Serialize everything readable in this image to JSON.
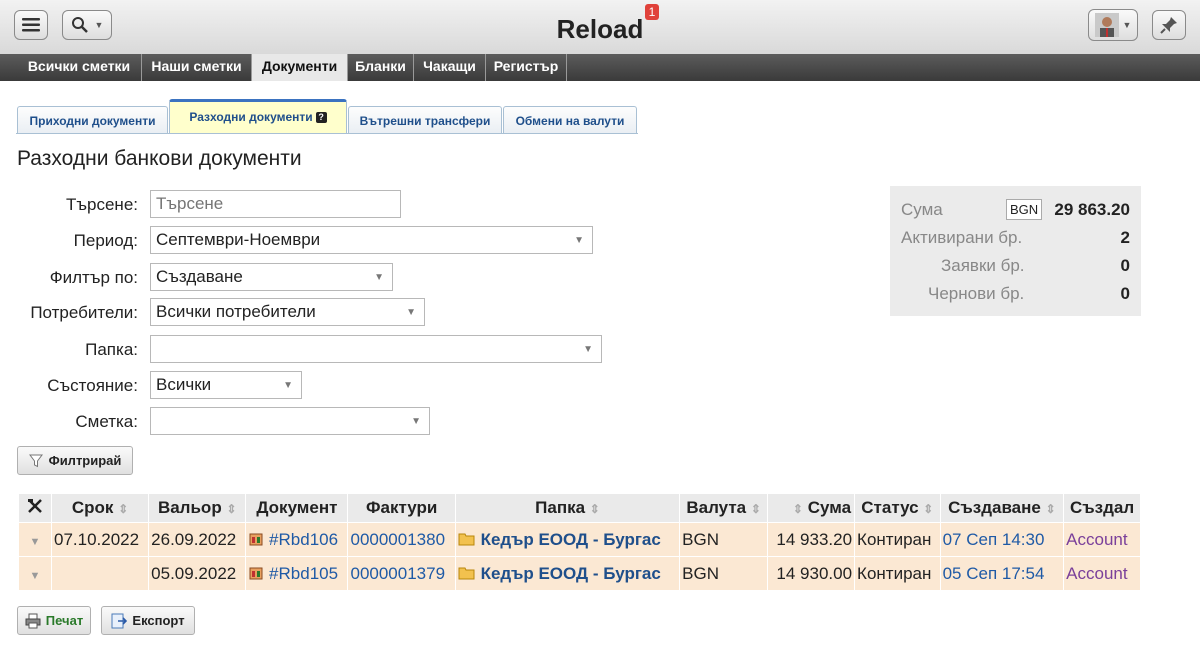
{
  "header": {
    "title": "Reload",
    "notification_count": "1"
  },
  "nav": {
    "tabs": [
      {
        "label": "Всички сметки"
      },
      {
        "label": "Наши сметки"
      },
      {
        "label": "Документи"
      },
      {
        "label": "Бланки"
      },
      {
        "label": "Чакащи"
      },
      {
        "label": "Регистър"
      }
    ],
    "active": "Документи"
  },
  "subtabs": [
    {
      "label": "Приходни документи"
    },
    {
      "label": "Разходни документи"
    },
    {
      "label": "Вътрешни трансфери"
    },
    {
      "label": "Обмени на валути"
    }
  ],
  "page_title": "Разходни банкови документи",
  "form": {
    "search_label": "Търсене:",
    "search_placeholder": "Търсене",
    "period_label": "Период:",
    "period_value": "Септември-Ноември",
    "filter_by_label": "Филтър по:",
    "filter_by_value": "Създаване",
    "users_label": "Потребители:",
    "users_value": "Всички потребители",
    "folder_label": "Папка:",
    "folder_value": "",
    "state_label": "Състояние:",
    "state_value": "Всички",
    "account_label": "Сметка:",
    "account_value": "",
    "filter_button": "Филтрирай"
  },
  "summary": {
    "sum_label": "Сума",
    "currency": "BGN",
    "sum_value": "29 863.20",
    "activated_label": "Активирани бр.",
    "activated_value": "2",
    "requests_label": "Заявки бр.",
    "requests_value": "0",
    "drafts_label": "Чернови бр.",
    "drafts_value": "0"
  },
  "table": {
    "columns": [
      "Срок",
      "Вальор",
      "Документ",
      "Фактури",
      "Папка",
      "Валута",
      "Сума",
      "Статус",
      "Създаване",
      "Създал"
    ],
    "rows": [
      {
        "due": "07.10.2022",
        "value_date": "26.09.2022",
        "document": "#Rbd106",
        "invoice": "0000001380",
        "folder": "Кедър ЕООД - Бургас",
        "currency": "BGN",
        "amount": "14 933.20",
        "status": "Контиран",
        "created": "07 Сеп 14:30",
        "created_by": "Account"
      },
      {
        "due": "",
        "value_date": "05.09.2022",
        "document": "#Rbd105",
        "invoice": "0000001379",
        "folder": "Кедър ЕООД - Бургас",
        "currency": "BGN",
        "amount": "14 930.00",
        "status": "Контиран",
        "created": "05 Сеп 17:54",
        "created_by": "Account"
      }
    ]
  },
  "actions": {
    "print": "Печат",
    "export": "Експорт"
  }
}
